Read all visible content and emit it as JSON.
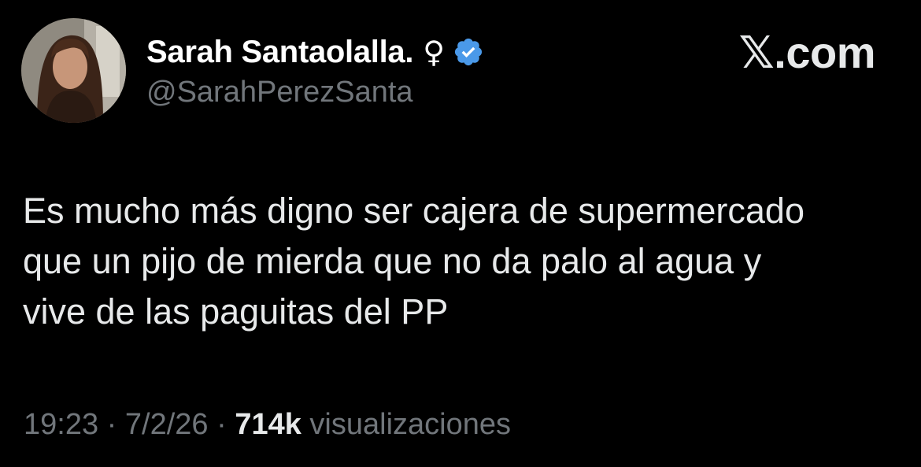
{
  "author": {
    "display_name": "Sarah Santaolalla.",
    "gender_symbol": "♀",
    "handle": "@SarahPerezSanta",
    "verified": true,
    "verified_color": "#4a99e9"
  },
  "brand": {
    "label": "𝕏.com"
  },
  "tweet": {
    "lines": [
      "Es mucho más digno ser cajera de supermercado",
      "que un pijo de mierda que no da palo al agua y",
      "vive de las paguitas del PP"
    ]
  },
  "meta": {
    "time": "19:23",
    "separator": " · ",
    "date": "7/2/26",
    "views_count": "714k",
    "views_label": " visualizaciones"
  },
  "colors": {
    "background": "#000000",
    "primary_text": "#e7e9ea",
    "secondary_text": "#71767b"
  }
}
